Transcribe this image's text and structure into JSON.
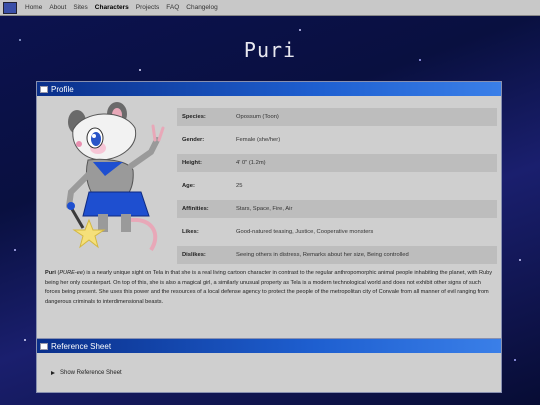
{
  "nav": {
    "items": [
      {
        "label": "Home"
      },
      {
        "label": "About"
      },
      {
        "label": "Sites"
      },
      {
        "label": "Characters",
        "active": true
      },
      {
        "label": "Projects"
      },
      {
        "label": "FAQ"
      },
      {
        "label": "Changelog"
      }
    ]
  },
  "page_title": "Puri",
  "profile": {
    "header": "Profile",
    "stats": [
      {
        "label": "Species:",
        "value": "Opossum (Toon)"
      },
      {
        "label": "Gender:",
        "value": "Female (she/her)"
      },
      {
        "label": "Height:",
        "value": "4' 0\" (1.2m)"
      },
      {
        "label": "Age:",
        "value": "25"
      },
      {
        "label": "Affinities:",
        "value": "Stars, Space, Fire, Air"
      },
      {
        "label": "Likes:",
        "value": "Good-natured teasing, Justice, Cooperative monsters"
      },
      {
        "label": "Dislikes:",
        "value": "Seeing others in distress, Remarks about her size, Being controlled"
      }
    ],
    "bio": {
      "name": "Puri",
      "pronunciation": "PURE-ee",
      "text": "is a nearly unique sight on Tela in that she is a real living cartoon character in contrast to the regular anthropomorphic animal people inhabiting the planet, with Ruby being her only counterpart. On top of this, she is also a magical girl, a similarly unusual property as Tela is a modern technological world and does not exhibit other signs of such forces being present. She uses this power and the resources of a local defense agency to protect the people of the metropolitan city of Convale from all manner of evil ranging from dangerous criminals to interdimensional beasts."
    }
  },
  "reference": {
    "header": "Reference Sheet",
    "toggle_label": "Show Reference Sheet"
  },
  "colors": {
    "header_blue": "#1e5fd0",
    "panel_bg": "#cfcfcf",
    "skirt_blue": "#1e4fd0",
    "star_yellow": "#f5e07a"
  }
}
